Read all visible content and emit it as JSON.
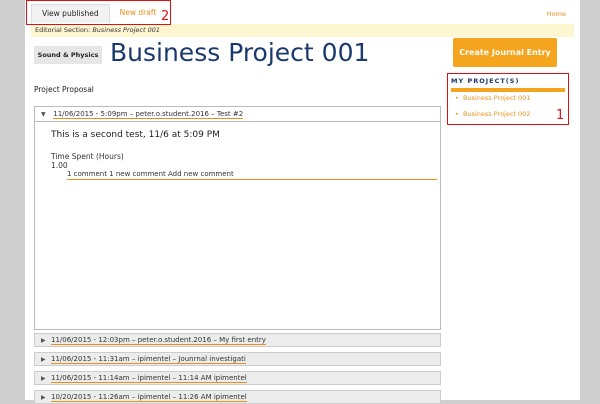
{
  "tabs": [
    {
      "label": "View published"
    },
    {
      "label": "New draft"
    }
  ],
  "home_link": "Home",
  "editorial": {
    "prefix": "Editorial Section:",
    "name": "Business Project 001"
  },
  "section_badge": "Sound & Physics",
  "page_title": "Business Project 001",
  "create_button": "Create Journal Entry",
  "my_projects": {
    "heading": "MY PROJECT(S)",
    "items": [
      "Business Project 001",
      "Business Project 002"
    ]
  },
  "proposal_label": "Project Proposal",
  "open_entry": {
    "header": "11/06/2015 - 5:09pm – peter.o.student.2016 – Test #2",
    "body": "This is a second test, 11/6 at 5:09 PM",
    "time_label": "Time Spent (Hours)",
    "time_value": "1.00",
    "comments": "1 comment 1 new comment Add new comment"
  },
  "entries": [
    "11/06/2015 - 12:03pm – peter.o.student.2016 – My first entry",
    "11/06/2015 - 11:31am – ipimentel – Jounrnal investigati",
    "11/06/2015 - 11:14am – ipimentel – 11:14 AM ipimentel",
    "10/20/2015 - 11:26am – ipimentel – 11:26 AM ipimentel"
  ],
  "annotations": [
    "2",
    "1"
  ]
}
